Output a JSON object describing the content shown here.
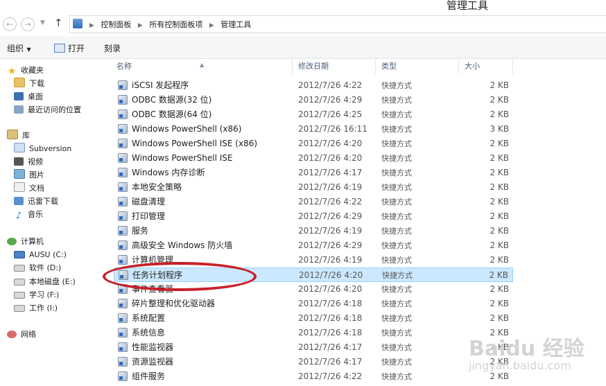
{
  "window": {
    "title": "管理工具"
  },
  "address": {
    "back_glyph": "←",
    "forward_glyph": "→",
    "up_glyph": "↑",
    "crumbs": [
      "控制面板",
      "所有控制面板项",
      "管理工具"
    ]
  },
  "toolbar": {
    "organize": "组织",
    "open": "打开",
    "burn": "刻录"
  },
  "nav": {
    "favorites": "收藏夹",
    "downloads": "下载",
    "desktop": "桌面",
    "recent": "最近访问的位置",
    "libraries": "库",
    "subversion": "Subversion",
    "videos": "视频",
    "pictures": "图片",
    "documents": "文档",
    "xunlei": "迅雷下载",
    "music": "音乐",
    "computer": "计算机",
    "drive_c": "AUSU (C:)",
    "drive_d": "软件 (D:)",
    "drive_e": "本地磁盘 (E:)",
    "drive_f": "学习 (F:)",
    "drive_i": "工作 (I:)",
    "network": "网络"
  },
  "columns": {
    "name": "名称",
    "date": "修改日期",
    "type": "类型",
    "size": "大小"
  },
  "files": [
    {
      "name": "iSCSI 发起程序",
      "date": "2012/7/26 4:22",
      "type": "快捷方式",
      "size": "2 KB"
    },
    {
      "name": "ODBC 数据源(32 位)",
      "date": "2012/7/26 4:29",
      "type": "快捷方式",
      "size": "2 KB"
    },
    {
      "name": "ODBC 数据源(64 位)",
      "date": "2012/7/26 4:25",
      "type": "快捷方式",
      "size": "2 KB"
    },
    {
      "name": "Windows PowerShell (x86)",
      "date": "2012/7/26 16:11",
      "type": "快捷方式",
      "size": "3 KB"
    },
    {
      "name": "Windows PowerShell ISE (x86)",
      "date": "2012/7/26 4:20",
      "type": "快捷方式",
      "size": "2 KB"
    },
    {
      "name": "Windows PowerShell ISE",
      "date": "2012/7/26 4:20",
      "type": "快捷方式",
      "size": "2 KB"
    },
    {
      "name": "Windows 内存诊断",
      "date": "2012/7/26 4:17",
      "type": "快捷方式",
      "size": "2 KB"
    },
    {
      "name": "本地安全策略",
      "date": "2012/7/26 4:19",
      "type": "快捷方式",
      "size": "2 KB"
    },
    {
      "name": "磁盘清理",
      "date": "2012/7/26 4:22",
      "type": "快捷方式",
      "size": "2 KB"
    },
    {
      "name": "打印管理",
      "date": "2012/7/26 4:29",
      "type": "快捷方式",
      "size": "2 KB"
    },
    {
      "name": "服务",
      "date": "2012/7/26 4:19",
      "type": "快捷方式",
      "size": "2 KB"
    },
    {
      "name": "高级安全 Windows 防火墙",
      "date": "2012/7/26 4:29",
      "type": "快捷方式",
      "size": "2 KB"
    },
    {
      "name": "计算机管理",
      "date": "2012/7/26 4:19",
      "type": "快捷方式",
      "size": "2 KB"
    },
    {
      "name": "任务计划程序",
      "date": "2012/7/26 4:20",
      "type": "快捷方式",
      "size": "2 KB",
      "selected": true
    },
    {
      "name": "事件查看器",
      "date": "2012/7/26 4:20",
      "type": "快捷方式",
      "size": "2 KB"
    },
    {
      "name": "碎片整理和优化驱动器",
      "date": "2012/7/26 4:18",
      "type": "快捷方式",
      "size": "2 KB"
    },
    {
      "name": "系统配置",
      "date": "2012/7/26 4:18",
      "type": "快捷方式",
      "size": "2 KB"
    },
    {
      "name": "系统信息",
      "date": "2012/7/26 4:18",
      "type": "快捷方式",
      "size": "2 KB"
    },
    {
      "name": "性能监视器",
      "date": "2012/7/26 4:17",
      "type": "快捷方式",
      "size": "2 KB"
    },
    {
      "name": "资源监视器",
      "date": "2012/7/26 4:17",
      "type": "快捷方式",
      "size": "2 KB"
    },
    {
      "name": "组件服务",
      "date": "2012/7/26 4:22",
      "type": "快捷方式",
      "size": "2 KB"
    }
  ],
  "watermark": {
    "brand": "Baidu 经验",
    "url": "jingyan.baidu.com"
  },
  "colors": {
    "selection_bg": "#cce8ff",
    "selection_border": "#99d1ff",
    "annotation": "#c8202a"
  }
}
